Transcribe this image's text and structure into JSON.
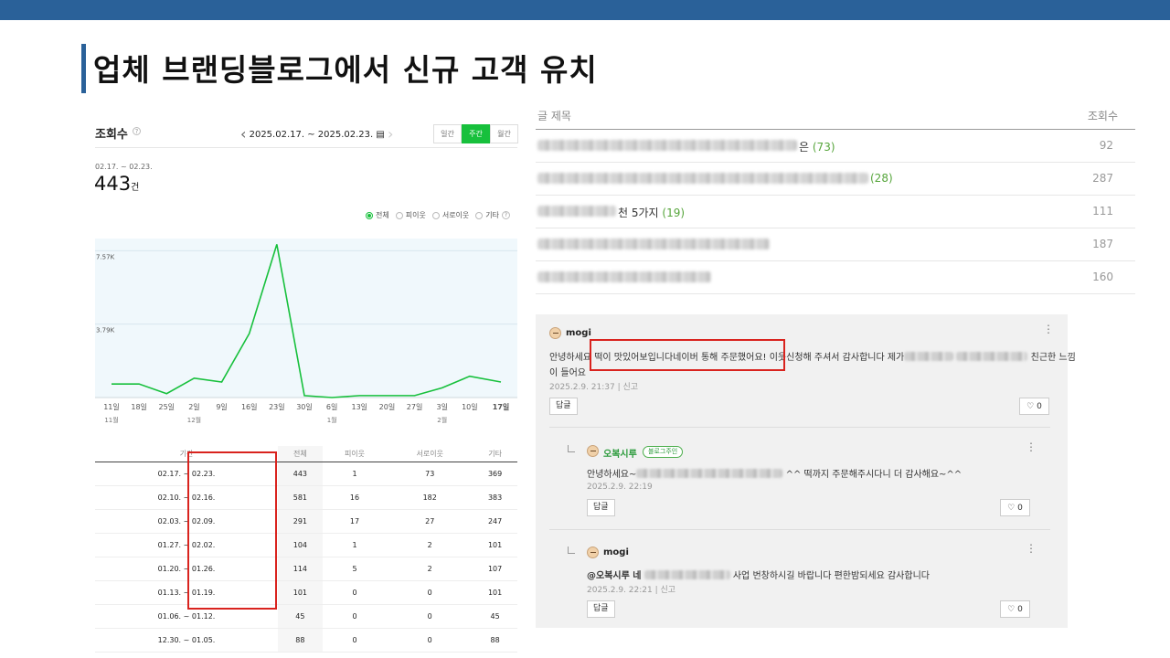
{
  "slide": {
    "title": "업체 브랜딩블로그에서 신규 고객 유치"
  },
  "stats": {
    "label": "조회수",
    "help": "?",
    "date_range": "2025.02.17. ~ 2025.02.23.",
    "period_tabs": [
      "일간",
      "주간",
      "월간"
    ],
    "active_period": "주간",
    "range_small": "02.17. ~ 02.23.",
    "total_value": "443",
    "total_unit": "건",
    "legend": [
      "전체",
      "피이웃",
      "서로이웃",
      "기타"
    ],
    "legend_help": "?"
  },
  "chart_data": {
    "type": "line",
    "series": [
      {
        "values": [
          0.7,
          0.7,
          0.2,
          1.0,
          0.8,
          3.3,
          7.9,
          0.1,
          0.0,
          0.1,
          0.1,
          0.1,
          0.5,
          1.1,
          0.8
        ]
      }
    ],
    "x": [
      "11일",
      "18일",
      "25일",
      "2일",
      "9일",
      "16일",
      "23일",
      "30일",
      "6일",
      "13일",
      "20일",
      "27일",
      "3일",
      "10일",
      "17일"
    ],
    "month_labels": [
      {
        "at": "11일",
        "label": "11월"
      },
      {
        "at": "2일",
        "label": "12월"
      },
      {
        "at": "6일",
        "label": "1월"
      },
      {
        "at": "3일",
        "label": "2월"
      }
    ],
    "y_ticks": [
      {
        "value": 3.79,
        "label": "3.79K"
      },
      {
        "value": 7.57,
        "label": "7.57K"
      }
    ],
    "ylim": [
      0,
      8.2
    ],
    "grid": true,
    "color": "#17c03c"
  },
  "stat_table": {
    "headers": [
      "기간",
      "전체",
      "피이웃",
      "서로이웃",
      "기타"
    ],
    "rows": [
      [
        "02.17. ~ 02.23.",
        "443",
        "1",
        "73",
        "369"
      ],
      [
        "02.10. ~ 02.16.",
        "581",
        "16",
        "182",
        "383"
      ],
      [
        "02.03. ~ 02.09.",
        "291",
        "17",
        "27",
        "247"
      ],
      [
        "01.27. ~ 02.02.",
        "104",
        "1",
        "2",
        "101"
      ],
      [
        "01.20. ~ 01.26.",
        "114",
        "5",
        "2",
        "107"
      ],
      [
        "01.13. ~ 01.19.",
        "101",
        "0",
        "0",
        "101"
      ],
      [
        "01.06. ~ 01.12.",
        "45",
        "0",
        "0",
        "45"
      ],
      [
        "12.30. ~ 01.05.",
        "88",
        "0",
        "0",
        "88"
      ]
    ]
  },
  "posts": {
    "header_title": "글 제목",
    "header_views": "조회수",
    "rows": [
      {
        "title_visible": "은",
        "comments": "(73)",
        "views": "92"
      },
      {
        "title_visible": "",
        "comments": "(28)",
        "views": "287"
      },
      {
        "title_visible": "천 5가지",
        "comments": "(19)",
        "views": "111"
      },
      {
        "title_visible": "",
        "comments": "",
        "views": "187"
      },
      {
        "title_visible": "",
        "comments": "",
        "views": "160"
      }
    ]
  },
  "comments": {
    "main": {
      "author": "mogi",
      "line1_a": "안녕하세요",
      "line1_b": "떡이 맛있어보입니다네이버 통해 주문했어요! 이",
      "line1_c": "웃신청해 주셔서 감사합니다 제가",
      "line1_d": "친근한 느낌",
      "line2": "이 들어요",
      "date": "2025.2.9. 21:37",
      "report": "신고",
      "reply_button": "답글",
      "likes": "0"
    },
    "reply1": {
      "author": "오복시루",
      "badge": "블로그주인",
      "text_a": "안녕하세요~",
      "text_b": "^^ 떡까지 주문해주시다니 더 감사해요~^^",
      "date": "2025.2.9. 22:19",
      "reply_button": "답글",
      "likes": "0"
    },
    "reply2": {
      "author": "mogi",
      "text_a": "@오복시루 네",
      "text_b": "사업 번창하시길 바랍니다 편한밤되세요 감사합니다",
      "date": "2025.2.9. 22:21",
      "report": "신고",
      "reply_button": "답글",
      "likes": "0"
    }
  }
}
